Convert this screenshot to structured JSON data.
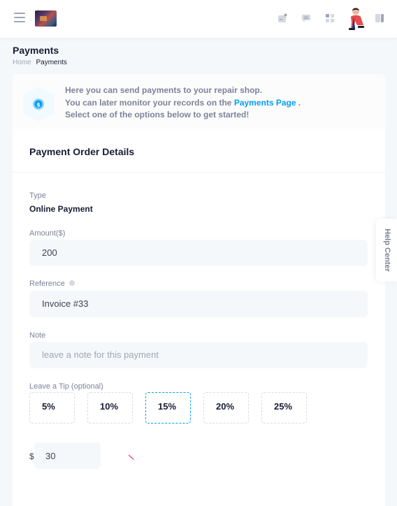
{
  "header": {
    "icons": [
      "menu-icon",
      "app-logo",
      "notification-icon",
      "chat-icon",
      "apps-icon",
      "user-avatar",
      "panel-toggle-icon"
    ]
  },
  "page": {
    "title": "Payments",
    "breadcrumb": {
      "home": "Home",
      "current": "Payments"
    }
  },
  "notice": {
    "line1": "Here you can send payments to your repair shop.",
    "line2_prefix": "You can later monitor your records on the",
    "line2_link": "Payments Page",
    "line2_suffix": ".",
    "line3": "Select one of the options below to get started!"
  },
  "form": {
    "title": "Payment Order Details",
    "type_label": "Type",
    "type_value": "Online Payment",
    "amount_label": "Amount($)",
    "amount_value": "200",
    "reference_label": "Reference",
    "reference_value": "Invoice #33",
    "note_label": "Note",
    "note_placeholder": "leave a note for this payment",
    "tip_label": "Leave a Tip (optional)",
    "tip_options": [
      "5%",
      "10%",
      "15%",
      "20%",
      "25%"
    ],
    "tip_selected": "15%",
    "currency_symbol": "$",
    "tip_amount": "30"
  },
  "help_center": {
    "label": "Help Center"
  },
  "colors": {
    "accent": "#009ef7",
    "text_dark": "#181c32",
    "text_muted": "#7e8299",
    "field_bg": "#f5f8fa",
    "page_bg": "#f5f8fa"
  }
}
